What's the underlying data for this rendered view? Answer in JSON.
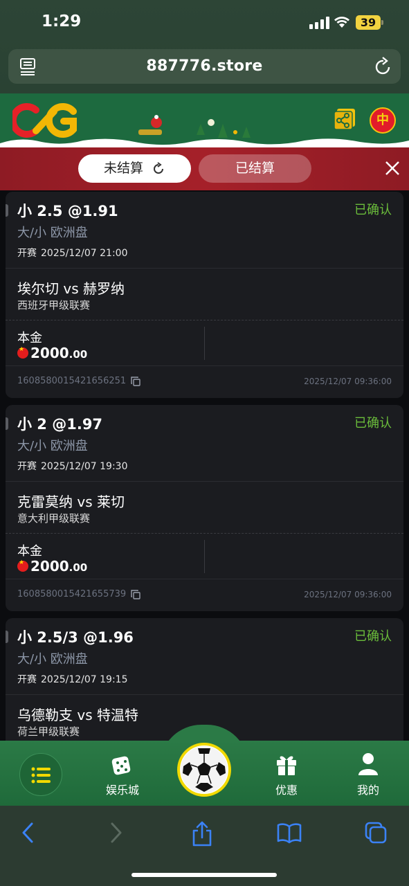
{
  "status_bar": {
    "time": "1:29",
    "battery": "39"
  },
  "browser": {
    "url": "887776.store"
  },
  "header": {
    "lang": "中"
  },
  "tabs": {
    "active": "未结算",
    "inactive": "已结算"
  },
  "bets": [
    {
      "pick": "小 2.5 @1.91",
      "status": "已确认",
      "market": "大/小 欧洲盘",
      "kickoff_label": "开赛",
      "kickoff": "2025/12/07 21:00",
      "match": "埃尔切 vs 赫罗纳",
      "league": "西班牙甲级联赛",
      "stake_label": "本金",
      "stake_int": "2000",
      "stake_dec": ".00",
      "order_id": "1608580015421656251",
      "order_time": "2025/12/07 09:36:00"
    },
    {
      "pick": "小 2 @1.97",
      "status": "已确认",
      "market": "大/小 欧洲盘",
      "kickoff_label": "开赛",
      "kickoff": "2025/12/07 19:30",
      "match": "克雷莫纳 vs 莱切",
      "league": "意大利甲级联赛",
      "stake_label": "本金",
      "stake_int": "2000",
      "stake_dec": ".00",
      "order_id": "1608580015421655739",
      "order_time": "2025/12/07 09:36:00"
    },
    {
      "pick": "小 2.5/3 @1.96",
      "status": "已确认",
      "market": "大/小 欧洲盘",
      "kickoff_label": "开赛",
      "kickoff": "2025/12/07 19:15",
      "match": "乌德勒支 vs 特温特",
      "league": "荷兰甲级联赛"
    }
  ],
  "nav": {
    "casino": "娱乐城",
    "promo": "优惠",
    "mine": "我的"
  },
  "colors": {
    "brand_green": "#1d6a3f",
    "tab_bar_red": "#a52029",
    "confirmed_green": "#6bbd3b",
    "ball_ring": "#f1d900"
  }
}
